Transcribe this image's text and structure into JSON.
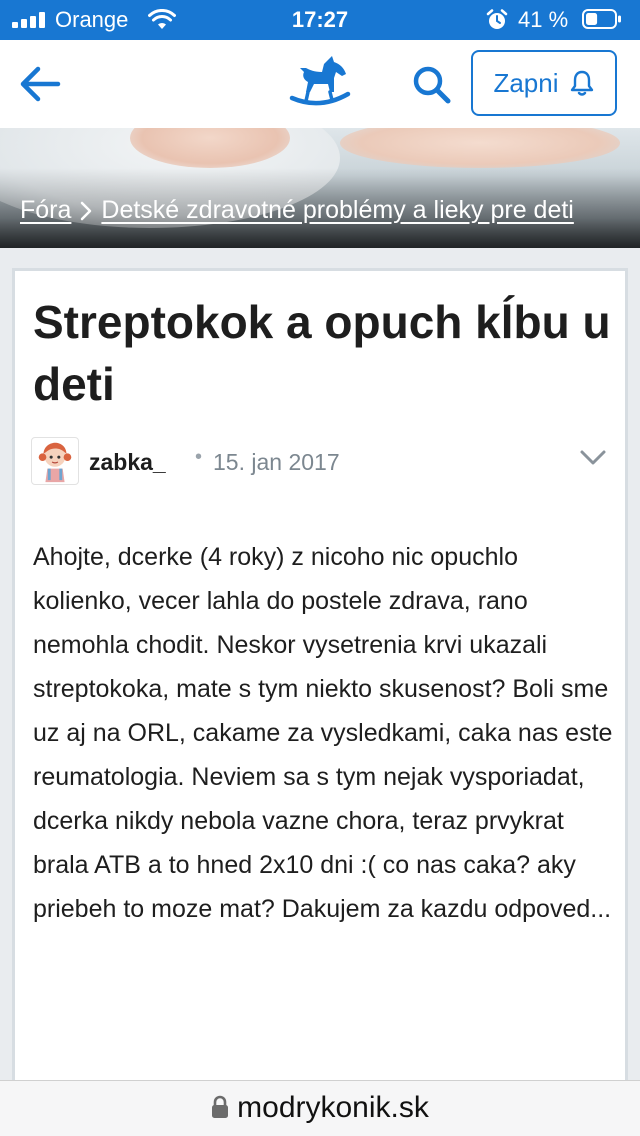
{
  "status_bar": {
    "carrier": "Orange",
    "time": "17:27",
    "battery": "41 %",
    "battery_level": 0.41
  },
  "navbar": {
    "notify_label": "Zapni"
  },
  "breadcrumb": {
    "root": "Fóra",
    "category": "Detské zdravotné problémy a lieky pre deti"
  },
  "post": {
    "title": "Streptokok a opuch kĺbu u deti",
    "author": "zabka_",
    "separator": "•",
    "date": "15. jan 2017",
    "body": "Ahojte, dcerke (4 roky) z nicoho nic opuchlo kolienko, vecer lahla do postele zdrava, rano nemohla chodit. Neskor vysetrenia krvi ukazali streptokoka, mate s tym niekto skusenost? Boli sme uz aj na ORL, cakame za vysledkami, caka nas este reumatologia. Neviem sa s tym nejak vysporiadat, dcerka nikdy nebola vazne chora, teraz prvykrat brala ATB a to hned 2x10 dni :( co nas caka? aky priebeh to moze mat? Dakujem za kazdu odpoved..."
  },
  "browser": {
    "url": "modrykonik.sk"
  },
  "colors": {
    "brand": "#1877d2",
    "text": "#1e1e1e",
    "muted": "#7c8790"
  },
  "icons": [
    "signal-icon",
    "wifi-icon",
    "alarm-icon",
    "battery-icon",
    "back-arrow-icon",
    "rocking-horse-logo-icon",
    "search-icon",
    "bell-icon",
    "chevron-right-icon",
    "chevron-down-icon",
    "lock-icon"
  ]
}
